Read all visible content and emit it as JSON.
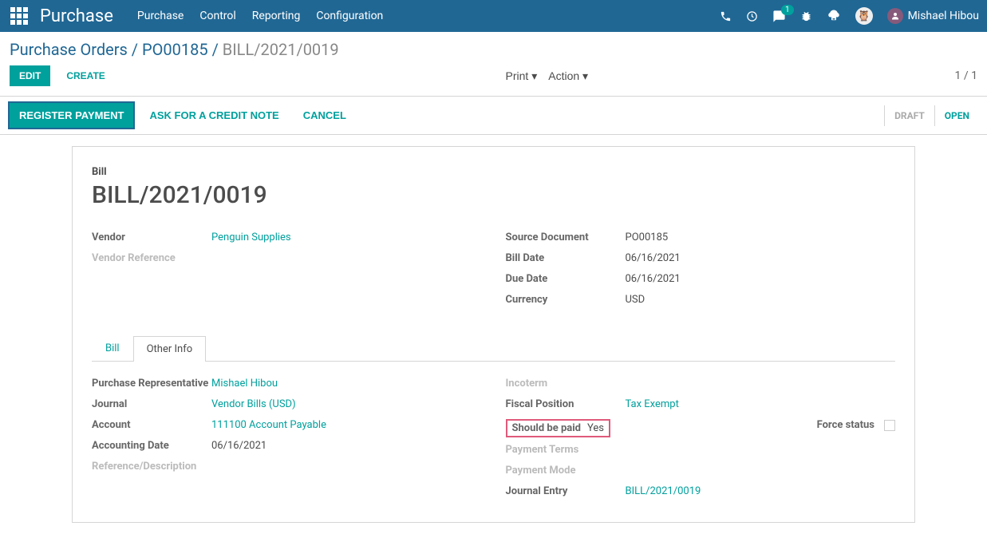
{
  "navbar": {
    "brand": "Purchase",
    "menu": [
      "Purchase",
      "Control",
      "Reporting",
      "Configuration"
    ],
    "activity_count": "1",
    "user_name": "Mishael Hibou"
  },
  "breadcrumb": {
    "items": [
      "Purchase Orders",
      "PO00185"
    ],
    "current": "BILL/2021/0019"
  },
  "buttons": {
    "edit": "EDIT",
    "create": "CREATE",
    "print": "Print",
    "action": "Action",
    "register_payment": "REGISTER PAYMENT",
    "ask_credit": "ASK FOR A CREDIT NOTE",
    "cancel": "CANCEL"
  },
  "pager": "1 / 1",
  "status": {
    "draft": "DRAFT",
    "open": "OPEN"
  },
  "sheet": {
    "title_label": "Bill",
    "title": "BILL/2021/0019",
    "left": {
      "vendor_label": "Vendor",
      "vendor": "Penguin Supplies",
      "vendor_ref_label": "Vendor Reference"
    },
    "right": {
      "source_label": "Source Document",
      "source": "PO00185",
      "billdate_label": "Bill Date",
      "billdate": "06/16/2021",
      "duedate_label": "Due Date",
      "duedate": "06/16/2021",
      "currency_label": "Currency",
      "currency": "USD"
    }
  },
  "tabs": {
    "bill": "Bill",
    "other": "Other Info"
  },
  "other_info": {
    "left": {
      "rep_label": "Purchase Representative",
      "rep": "Mishael Hibou",
      "journal_label": "Journal",
      "journal": "Vendor Bills (USD)",
      "account_label": "Account",
      "account": "111100 Account Payable",
      "accdate_label": "Accounting Date",
      "accdate": "06/16/2021",
      "refdesc_label": "Reference/Description"
    },
    "right": {
      "incoterm_label": "Incoterm",
      "fiscal_label": "Fiscal Position",
      "fiscal": "Tax Exempt",
      "paid_label": "Should be paid",
      "paid": "Yes",
      "force_label": "Force status",
      "payterms_label": "Payment Terms",
      "paymode_label": "Payment Mode",
      "journal_entry_label": "Journal Entry",
      "journal_entry": "BILL/2021/0019"
    }
  }
}
